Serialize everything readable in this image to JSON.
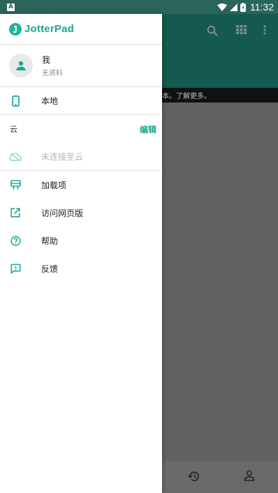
{
  "status_bar": {
    "left_icon": "A",
    "time": "11:32"
  },
  "background_app": {
    "banner_text": "本。了解更多。"
  },
  "drawer": {
    "app_name": "JotterPad",
    "profile": {
      "name": "我",
      "subtitle": "无资料"
    },
    "local_label": "本地",
    "cloud": {
      "section_title": "云",
      "edit_label": "编辑",
      "not_connected_label": "未连接至云"
    },
    "menu": [
      {
        "label": "加载项",
        "icon": "addons-icon"
      },
      {
        "label": "访问网页版",
        "icon": "open-external-icon"
      },
      {
        "label": "帮助",
        "icon": "help-icon"
      },
      {
        "label": "反馈",
        "icon": "feedback-icon"
      }
    ]
  },
  "colors": {
    "accent": "#1aa894",
    "status_bar": "#2a645a",
    "toolbar": "#145a50"
  }
}
